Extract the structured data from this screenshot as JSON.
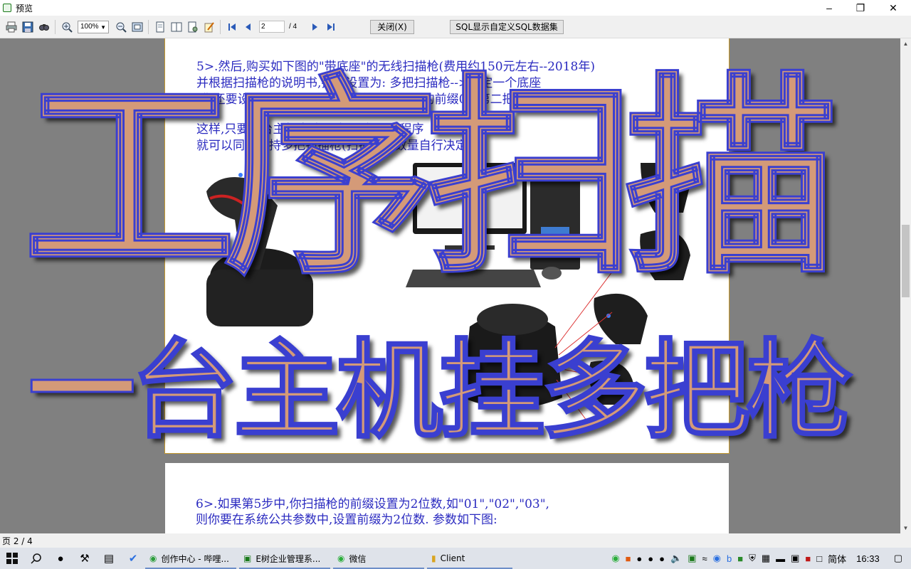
{
  "window": {
    "title": "预览"
  },
  "toolbar": {
    "zoom": "100%",
    "page_current": "2",
    "page_total": "/ 4",
    "close_label": "关闭(X)",
    "sql_label": "SQL显示自定义SQL数据集"
  },
  "document": {
    "page1_lines": [
      "5>.然后,购买如下图的\"带底座\"的无线扫描枪(费用约150元左右--2018年)",
      "并根据扫描枪的说明书,把它设置为: 多把扫描枪-->绑定一个底座",
      "(你还要设置扫描枪的前缀, 如: 第一把设置的前缀01,第二把02....)",
      "这样,只要一台主机电脑,运行一个ERP程序",
      "就可以同时支持多把扫描枪(扫描枪的数量自行决定)"
    ],
    "page2_lines": [
      "6>.如果第5步中,你扫描枪的前缀设置为2位数,如\"01\",\"02\",\"03\",",
      "则你要在系统公共参数中,设置前缀为2位数. 参数如下图:"
    ]
  },
  "overlay": {
    "line1": "工序扫描",
    "line2": "一台主机挂多把枪"
  },
  "status": {
    "page_text": "页 2 / 4"
  },
  "taskbar": {
    "apps": [
      {
        "label": "创作中心 - 哔哩..."
      },
      {
        "label": "E树企业管理系..."
      },
      {
        "label": "微信"
      },
      {
        "label": "Client"
      }
    ],
    "ime": "简体",
    "time": "16:33"
  },
  "colors": {
    "overlay_fill": "#d49a78",
    "overlay_stroke": "#3a3fd0",
    "doc_text": "#2b2bc0"
  }
}
